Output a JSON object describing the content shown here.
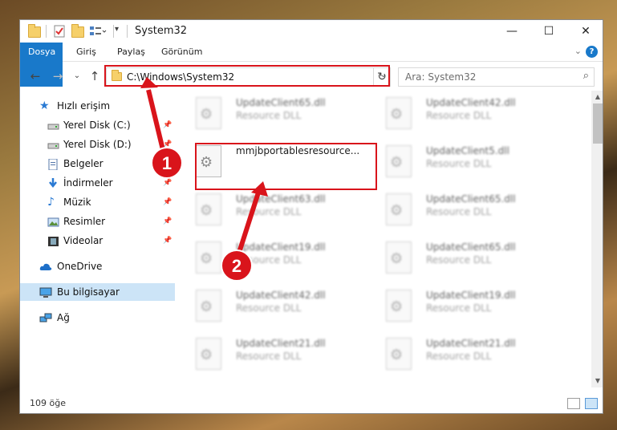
{
  "window": {
    "title": "System32",
    "controls": {
      "minimize": "—",
      "maximize": "☐",
      "close": "✕"
    }
  },
  "ribbon": {
    "tabs": [
      "Dosya",
      "Giriş",
      "Paylaş",
      "Görünüm"
    ],
    "help": "?",
    "collapse": "⌄"
  },
  "navigation": {
    "back": "←",
    "forward": "→",
    "recent": "⌄",
    "up": "↑",
    "address": "C:\\Windows\\System32",
    "dropdown": "⌄",
    "refresh": "↻",
    "search_placeholder": "Ara: System32",
    "search_icon": "⌕"
  },
  "sidebar": {
    "items": [
      {
        "label": "Hızlı erişim",
        "icon": "star-icon",
        "pinned": false
      },
      {
        "label": "Yerel Disk (C:)",
        "icon": "drive-icon",
        "pinned": true
      },
      {
        "label": "Yerel Disk (D:)",
        "icon": "drive-icon",
        "pinned": true
      },
      {
        "label": "Belgeler",
        "icon": "documents-icon",
        "pinned": true
      },
      {
        "label": "İndirmeler",
        "icon": "download-icon",
        "pinned": true
      },
      {
        "label": "Müzik",
        "icon": "music-icon",
        "pinned": true
      },
      {
        "label": "Resimler",
        "icon": "pictures-icon",
        "pinned": true
      },
      {
        "label": "Videolar",
        "icon": "video-icon",
        "pinned": true
      },
      {
        "label": "OneDrive",
        "icon": "cloud-icon",
        "pinned": false
      },
      {
        "label": "Bu bilgisayar",
        "icon": "computer-icon",
        "pinned": false
      },
      {
        "label": "Ağ",
        "icon": "network-icon",
        "pinned": false
      }
    ],
    "pin_glyph": "📌"
  },
  "files": [
    {
      "name": "UpdateClient65.dll",
      "desc": "Resource DLL"
    },
    {
      "name": "UpdateClient42.dll",
      "desc": "Resource DLL"
    },
    {
      "name": "mmjbportablesresource...",
      "desc": ""
    },
    {
      "name": "UpdateClient5.dll",
      "desc": "Resource DLL"
    },
    {
      "name": "UpdateClient63.dll",
      "desc": "Resource DLL"
    },
    {
      "name": "UpdateClient65.dll",
      "desc": "Resource DLL"
    },
    {
      "name": "UpdateClient19.dll",
      "desc": "Resource DLL"
    },
    {
      "name": "UpdateClient65.dll",
      "desc": "Resource DLL"
    },
    {
      "name": "UpdateClient42.dll",
      "desc": "Resource DLL"
    },
    {
      "name": "UpdateClient19.dll",
      "desc": "Resource DLL"
    },
    {
      "name": "UpdateClient21.dll",
      "desc": "Resource DLL"
    },
    {
      "name": "UpdateClient21.dll",
      "desc": "Resource DLL"
    }
  ],
  "status": {
    "count": "109 öğe"
  },
  "annotations": {
    "step1": "1",
    "step2": "2",
    "color": "#d9141b"
  }
}
